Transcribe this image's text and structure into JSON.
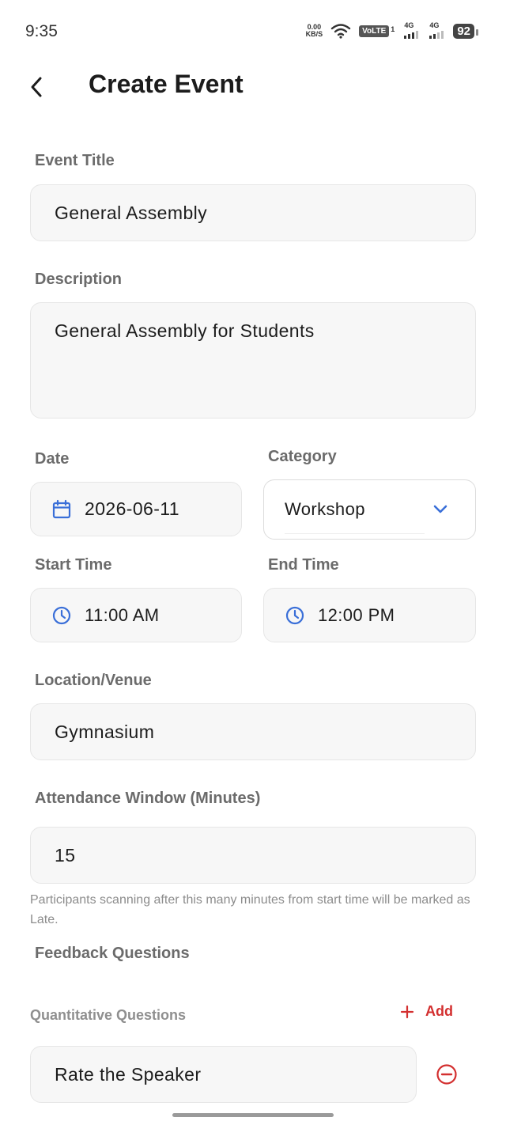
{
  "status_bar": {
    "time": "9:35",
    "net_speed_value": "0.00",
    "net_speed_unit": "KB/S",
    "volte": "VoLTE",
    "sim1_superscript": "1",
    "sim1_network": "4G",
    "sim2_network": "4G",
    "battery": "92"
  },
  "header": {
    "title": "Create Event",
    "back_icon": "back-arrow-icon"
  },
  "form": {
    "event_title": {
      "label": "Event Title",
      "value": "General Assembly"
    },
    "description": {
      "label": "Description",
      "value": "General Assembly for Students"
    },
    "date": {
      "label": "Date",
      "value": "2026-06-11",
      "icon": "calendar-icon"
    },
    "category": {
      "label": "Category",
      "value": "Workshop",
      "icon": "chevron-down-icon"
    },
    "start_time": {
      "label": "Start Time",
      "value": "11:00 AM",
      "icon": "clock-icon"
    },
    "end_time": {
      "label": "End Time",
      "value": "12:00 PM",
      "icon": "clock-icon"
    },
    "location": {
      "label": "Location/Venue",
      "value": "Gymnasium"
    },
    "attendance_window": {
      "label": "Attendance Window (Minutes)",
      "value": "15",
      "helper": "Participants scanning after this many minutes from start time will be marked as Late."
    }
  },
  "feedback": {
    "section_title": "Feedback Questions",
    "quantitative": {
      "label": "Quantitative Questions",
      "add_label": "Add",
      "questions": [
        {
          "value": "Rate the Speaker"
        }
      ]
    }
  },
  "colors": {
    "accent_blue": "#3a6fd8",
    "danger_red": "#d32f2f"
  }
}
